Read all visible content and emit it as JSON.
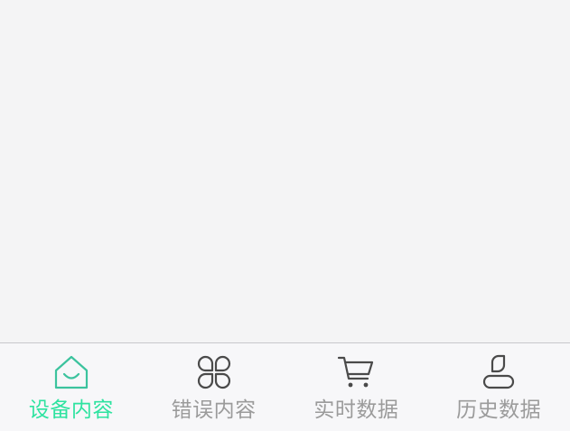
{
  "colors": {
    "background": "#f4f4f5",
    "tabbar_background": "#f7f7f9",
    "tabbar_border": "#c8c8cc",
    "active_label": "#2ee3a0",
    "active_icon": "#3cc39e",
    "inactive_label": "#9b9b9b",
    "inactive_icon": "#4a4a4a"
  },
  "tabbar": {
    "active_index": 0,
    "tabs": [
      {
        "label": "设备内容",
        "icon": "home-icon"
      },
      {
        "label": "错误内容",
        "icon": "clover-icon"
      },
      {
        "label": "实时数据",
        "icon": "cart-icon"
      },
      {
        "label": "历史数据",
        "icon": "user-icon"
      }
    ]
  }
}
